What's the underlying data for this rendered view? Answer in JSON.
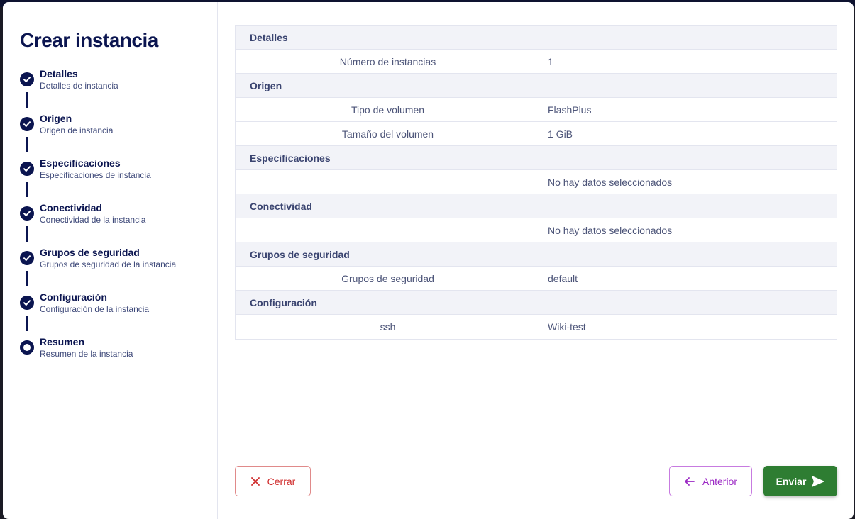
{
  "wizard": {
    "title": "Crear instancia",
    "steps": [
      {
        "title": "Detalles",
        "subtitle": "Detalles de instancia"
      },
      {
        "title": "Origen",
        "subtitle": "Origen de instancia"
      },
      {
        "title": "Especificaciones",
        "subtitle": "Especificaciones de instancia"
      },
      {
        "title": "Conectividad",
        "subtitle": "Conectividad de la instancia"
      },
      {
        "title": "Grupos de seguridad",
        "subtitle": "Grupos de seguridad de la instancia"
      },
      {
        "title": "Configuración",
        "subtitle": "Configuración de la instancia"
      },
      {
        "title": "Resumen",
        "subtitle": "Resumen de la instancia"
      }
    ]
  },
  "summary": {
    "sections": [
      {
        "title": "Detalles",
        "rows": [
          {
            "key": "Número de instancias",
            "value": "1"
          }
        ]
      },
      {
        "title": "Origen",
        "rows": [
          {
            "key": "Tipo de volumen",
            "value": "FlashPlus"
          },
          {
            "key": "Tamaño del volumen",
            "value": "1 GiB"
          }
        ]
      },
      {
        "title": "Especificaciones",
        "rows": [
          {
            "key": "",
            "value": "No hay datos seleccionados"
          }
        ]
      },
      {
        "title": "Conectividad",
        "rows": [
          {
            "key": "",
            "value": "No hay datos seleccionados"
          }
        ]
      },
      {
        "title": "Grupos de seguridad",
        "rows": [
          {
            "key": "Grupos de seguridad",
            "value": "default"
          }
        ]
      },
      {
        "title": "Configuración",
        "rows": [
          {
            "key": "ssh",
            "value": "Wiki-test"
          }
        ]
      }
    ]
  },
  "actions": {
    "close_label": "Cerrar",
    "prev_label": "Anterior",
    "send_label": "Enviar"
  },
  "colors": {
    "primary": "#0b1550",
    "close": "#cf2a2a",
    "prev": "#9b28c4",
    "send": "#2e7d32"
  }
}
